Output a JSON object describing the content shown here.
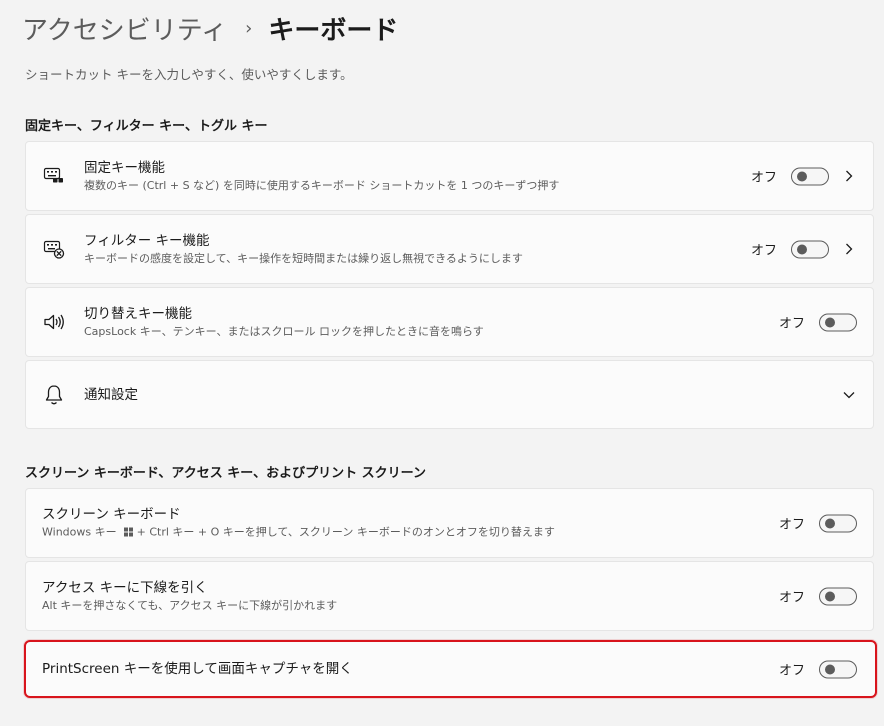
{
  "header": {
    "parent": "アクセシビリティ",
    "separator": "›",
    "current": "キーボード",
    "subtitle": "ショートカット キーを入力しやすく、使いやすくします。"
  },
  "section1": {
    "title": "固定キー、フィルター キー、トグル キー",
    "items": [
      {
        "title": "固定キー機能",
        "desc": "複数のキー (Ctrl + S など) を同時に使用するキーボード ショートカットを 1 つのキーずつ押す",
        "state": "オフ",
        "icon": "sticky-keys-icon"
      },
      {
        "title": "フィルター キー機能",
        "desc": "キーボードの感度を設定して、キー操作を短時間または繰り返し無視できるようにします",
        "state": "オフ",
        "icon": "filter-keys-icon"
      },
      {
        "title": "切り替えキー機能",
        "desc": "CapsLock キー、テンキー、またはスクロール ロックを押したときに音を鳴らす",
        "state": "オフ",
        "icon": "speaker-icon"
      }
    ],
    "notifications": {
      "title": "通知設定",
      "icon": "bell-icon"
    }
  },
  "section2": {
    "title": "スクリーン キーボード、アクセス キー、およびプリント スクリーン",
    "items": [
      {
        "title": "スクリーン キーボード",
        "desc_before": "Windows キー",
        "desc_after": " + Ctrl キー + O キーを押して、スクリーン キーボードのオンとオフを切り替えます",
        "state": "オフ"
      },
      {
        "title": "アクセス キーに下線を引く",
        "desc": "Alt キーを押さなくても、アクセス キーに下線が引かれます",
        "state": "オフ"
      },
      {
        "title": "PrintScreen キーを使用して画面キャプチャを開く",
        "state": "オフ"
      }
    ]
  },
  "colors": {
    "accent_highlight": "#d8141c",
    "background": "#f3f3f3",
    "card": "#fbfbfb"
  }
}
